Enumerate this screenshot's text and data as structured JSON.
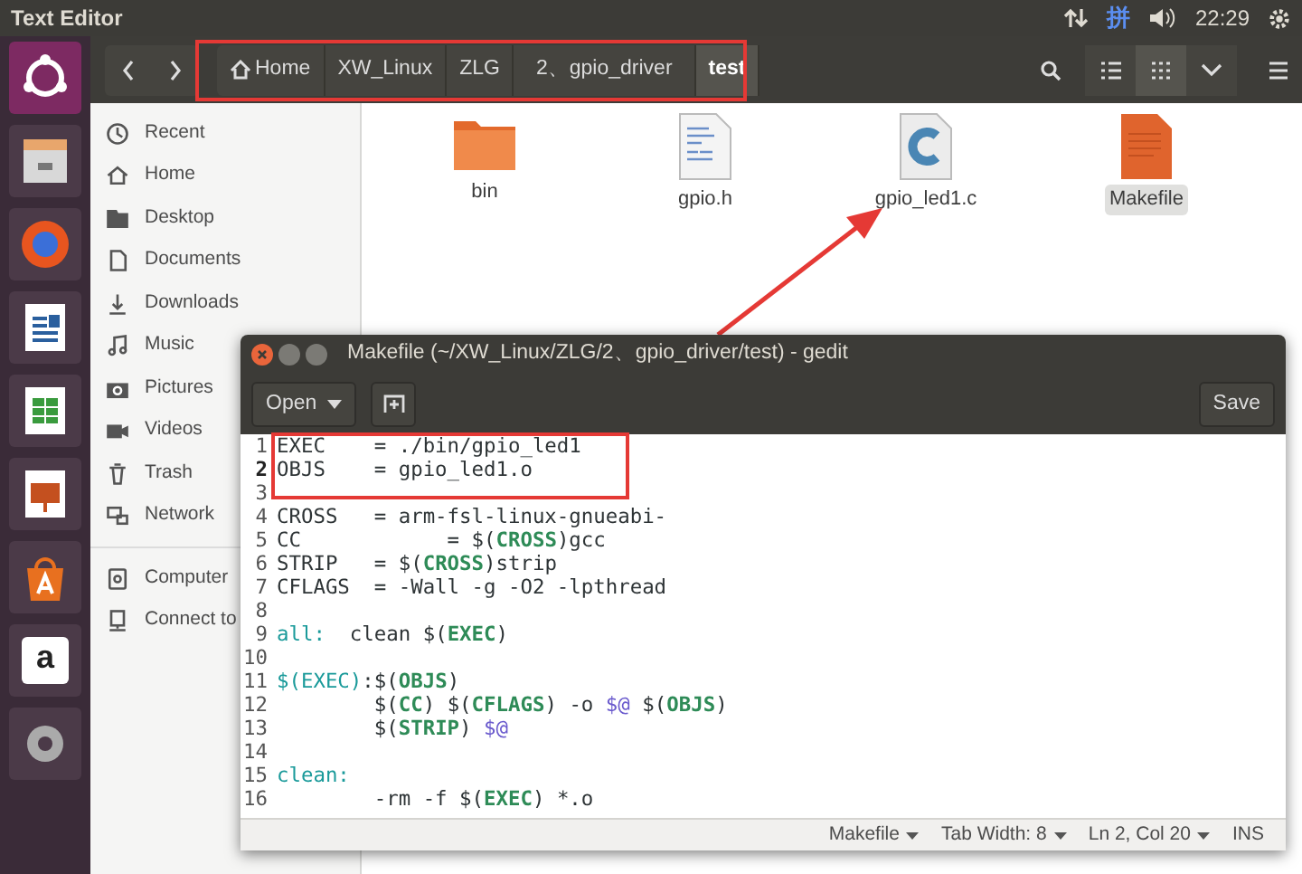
{
  "top_bar": {
    "title": "Text Editor",
    "input_method": "拼",
    "time": "22:29"
  },
  "launcher": {
    "store_letter": "a"
  },
  "file_manager": {
    "breadcrumbs": [
      {
        "label": "Home",
        "kind": "home",
        "selected": false
      },
      {
        "label": "XW_Linux",
        "kind": "folder",
        "selected": false
      },
      {
        "label": "ZLG",
        "kind": "folder",
        "selected": false
      },
      {
        "label": "2、gpio_driver",
        "kind": "folder",
        "selected": false
      },
      {
        "label": "test",
        "kind": "folder",
        "selected": true
      }
    ],
    "view_buttons": [
      {
        "kind": "list",
        "selected": false
      },
      {
        "kind": "grid",
        "selected": true
      }
    ],
    "sidebar": [
      {
        "label": "Recent",
        "kind": "recent"
      },
      {
        "label": "Home",
        "kind": "home"
      },
      {
        "label": "Desktop",
        "kind": "desktop"
      },
      {
        "label": "Documents",
        "kind": "documents"
      },
      {
        "label": "Downloads",
        "kind": "downloads"
      },
      {
        "label": "Music",
        "kind": "music"
      },
      {
        "label": "Pictures",
        "kind": "pictures"
      },
      {
        "label": "Videos",
        "kind": "videos"
      },
      {
        "label": "Trash",
        "kind": "trash"
      },
      {
        "label": "Network",
        "kind": "network"
      },
      {
        "label": "Computer",
        "kind": "computer"
      },
      {
        "label": "Connect to",
        "kind": "connect"
      }
    ],
    "files": [
      {
        "name": "bin",
        "kind": "folder",
        "selected": false
      },
      {
        "name": "gpio.h",
        "kind": "header",
        "selected": false
      },
      {
        "name": "gpio_led1.c",
        "kind": "c",
        "selected": false
      },
      {
        "name": "Makefile",
        "kind": "makefile",
        "selected": true
      }
    ]
  },
  "editor": {
    "title": "Makefile (~/XW_Linux/ZLG/2、gpio_driver/test) - gedit",
    "open_button": "Open",
    "save_button": "Save",
    "lines": [
      {
        "num": "1",
        "current": false,
        "segments": [
          {
            "text": "EXEC    = ./bin/gpio_led1",
            "kind": "plain"
          }
        ]
      },
      {
        "num": "2",
        "current": true,
        "segments": [
          {
            "text": "OBJS    = gpio_led1.o",
            "kind": "plain"
          }
        ]
      },
      {
        "num": "3",
        "current": false
      },
      {
        "num": "4",
        "current": false,
        "segments": [
          {
            "text": "CROSS   = arm-fsl-linux-gnueabi-",
            "kind": "plain"
          }
        ]
      },
      {
        "num": "5",
        "current": false,
        "segments": [
          {
            "text": "CC            = $(",
            "kind": "plain"
          },
          {
            "text": "CROSS",
            "kind": "var"
          },
          {
            "text": ")gcc",
            "kind": "plain"
          }
        ]
      },
      {
        "num": "6",
        "current": false,
        "segments": [
          {
            "text": "STRIP   = $(",
            "kind": "plain"
          },
          {
            "text": "CROSS",
            "kind": "var"
          },
          {
            "text": ")strip",
            "kind": "plain"
          }
        ]
      },
      {
        "num": "7",
        "current": false,
        "segments": [
          {
            "text": "CFLAGS  = -Wall -g -O2 -lpthread",
            "kind": "plain"
          }
        ]
      },
      {
        "num": "8",
        "current": false
      },
      {
        "num": "9",
        "current": false,
        "segments": [
          {
            "text": "all:",
            "kind": "target"
          },
          {
            "text": "  clean $(",
            "kind": "plain"
          },
          {
            "text": "EXEC",
            "kind": "var"
          },
          {
            "text": ")",
            "kind": "plain"
          }
        ]
      },
      {
        "num": "10",
        "current": false
      },
      {
        "num": "11",
        "current": false,
        "segments": [
          {
            "text": "$(EXEC)",
            "kind": "target"
          },
          {
            "text": ":$(",
            "kind": "plain"
          },
          {
            "text": "OBJS",
            "kind": "var"
          },
          {
            "text": ")",
            "kind": "plain"
          }
        ]
      },
      {
        "num": "12",
        "current": false,
        "segments": [
          {
            "text": "        $(",
            "kind": "plain"
          },
          {
            "text": "CC",
            "kind": "var"
          },
          {
            "text": ") $(",
            "kind": "plain"
          },
          {
            "text": "CFLAGS",
            "kind": "var"
          },
          {
            "text": ") -o ",
            "kind": "plain"
          },
          {
            "text": "$@",
            "kind": "auto"
          },
          {
            "text": " $(",
            "kind": "plain"
          },
          {
            "text": "OBJS",
            "kind": "var"
          },
          {
            "text": ")",
            "kind": "plain"
          }
        ]
      },
      {
        "num": "13",
        "current": false,
        "segments": [
          {
            "text": "        $(",
            "kind": "plain"
          },
          {
            "text": "STRIP",
            "kind": "var"
          },
          {
            "text": ") ",
            "kind": "plain"
          },
          {
            "text": "$@",
            "kind": "auto"
          }
        ]
      },
      {
        "num": "14",
        "current": false
      },
      {
        "num": "15",
        "current": false,
        "segments": [
          {
            "text": "clean:",
            "kind": "target"
          }
        ]
      },
      {
        "num": "16",
        "current": false,
        "segments": [
          {
            "text": "        -rm -f $(",
            "kind": "plain"
          },
          {
            "text": "EXEC",
            "kind": "var"
          },
          {
            "text": ") *.o",
            "kind": "plain"
          }
        ]
      }
    ],
    "status": {
      "language": "Makefile",
      "tab_width": "Tab Width: 8",
      "position": "Ln 2, Col 20",
      "mode": "INS"
    }
  }
}
